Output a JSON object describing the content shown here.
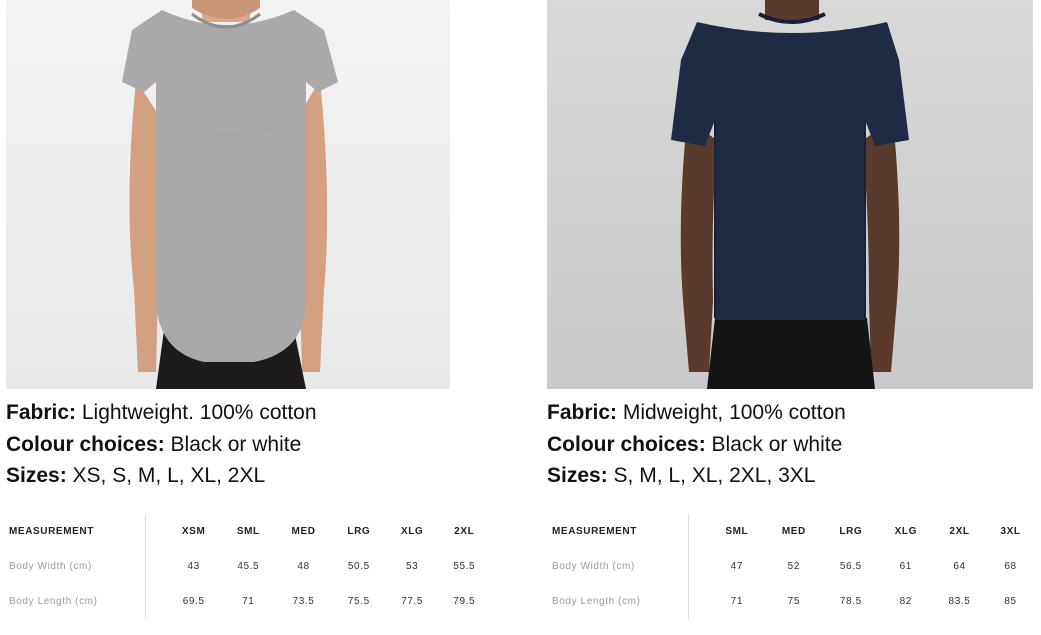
{
  "products": [
    {
      "fabric_label": "Fabric:",
      "fabric": "Lightweight. 100% cotton",
      "colour_label": "Colour choices:",
      "colour": "Black or white",
      "sizes_label": "Sizes:",
      "sizes": "XS, S, M, L, XL, 2XL",
      "shirt_color": "#a9a9a9",
      "table": {
        "header_label": "MEASUREMENT",
        "sizes": [
          "XSM",
          "SML",
          "MED",
          "LRG",
          "XLG",
          "2XL"
        ],
        "rows": [
          {
            "label": "Body Width (cm)",
            "values": [
              "43",
              "45.5",
              "48",
              "50.5",
              "53",
              "55.5"
            ]
          },
          {
            "label": "Body Length (cm)",
            "values": [
              "69.5",
              "71",
              "73.5",
              "75.5",
              "77.5",
              "79.5"
            ]
          }
        ]
      }
    },
    {
      "fabric_label": "Fabric:",
      "fabric": "Midweight, 100% cotton",
      "colour_label": "Colour choices:",
      "colour": "Black or white",
      "sizes_label": "Sizes:",
      "sizes": "S, M, L, XL, 2XL, 3XL",
      "shirt_color": "#1f2a44",
      "table": {
        "header_label": "MEASUREMENT",
        "sizes": [
          "SML",
          "MED",
          "LRG",
          "XLG",
          "2XL",
          "3XL"
        ],
        "rows": [
          {
            "label": "Body Width (cm)",
            "values": [
              "47",
              "52",
              "56.5",
              "61",
              "64",
              "68"
            ]
          },
          {
            "label": "Body Length (cm)",
            "values": [
              "71",
              "75",
              "78.5",
              "82",
              "83.5",
              "85"
            ]
          }
        ]
      }
    }
  ]
}
